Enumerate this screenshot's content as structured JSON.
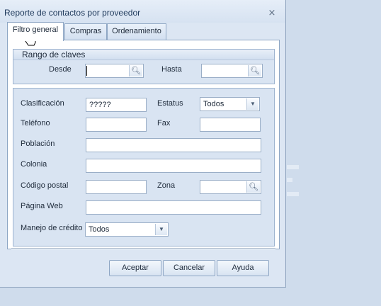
{
  "window": {
    "title": "Reporte de contactos por proveedor",
    "close_icon": "close-icon"
  },
  "tabs": [
    {
      "label": "Filtro general",
      "active": true
    },
    {
      "label": "Compras",
      "active": false
    },
    {
      "label": "Ordenamiento",
      "active": false
    }
  ],
  "rango_claves": {
    "title": "Rango de claves",
    "desde_label": "Desde",
    "desde_value": "",
    "hasta_label": "Hasta",
    "hasta_value": ""
  },
  "filters": {
    "clasificacion_label": "Clasificación",
    "clasificacion_value": "?????",
    "estatus_label": "Estatus",
    "estatus_value": "Todos",
    "telefono_label": "Teléfono",
    "telefono_value": "",
    "fax_label": "Fax",
    "fax_value": "",
    "poblacion_label": "Población",
    "poblacion_value": "",
    "colonia_label": "Colonia",
    "colonia_value": "",
    "codigo_postal_label": "Código postal",
    "codigo_postal_value": "",
    "zona_label": "Zona",
    "zona_value": "",
    "pagina_web_label": "Página Web",
    "pagina_web_value": "",
    "manejo_credito_label": "Manejo de crédito",
    "manejo_credito_value": "Todos"
  },
  "buttons": {
    "aceptar": "Aceptar",
    "cancelar": "Cancelar",
    "ayuda": "Ayuda"
  }
}
